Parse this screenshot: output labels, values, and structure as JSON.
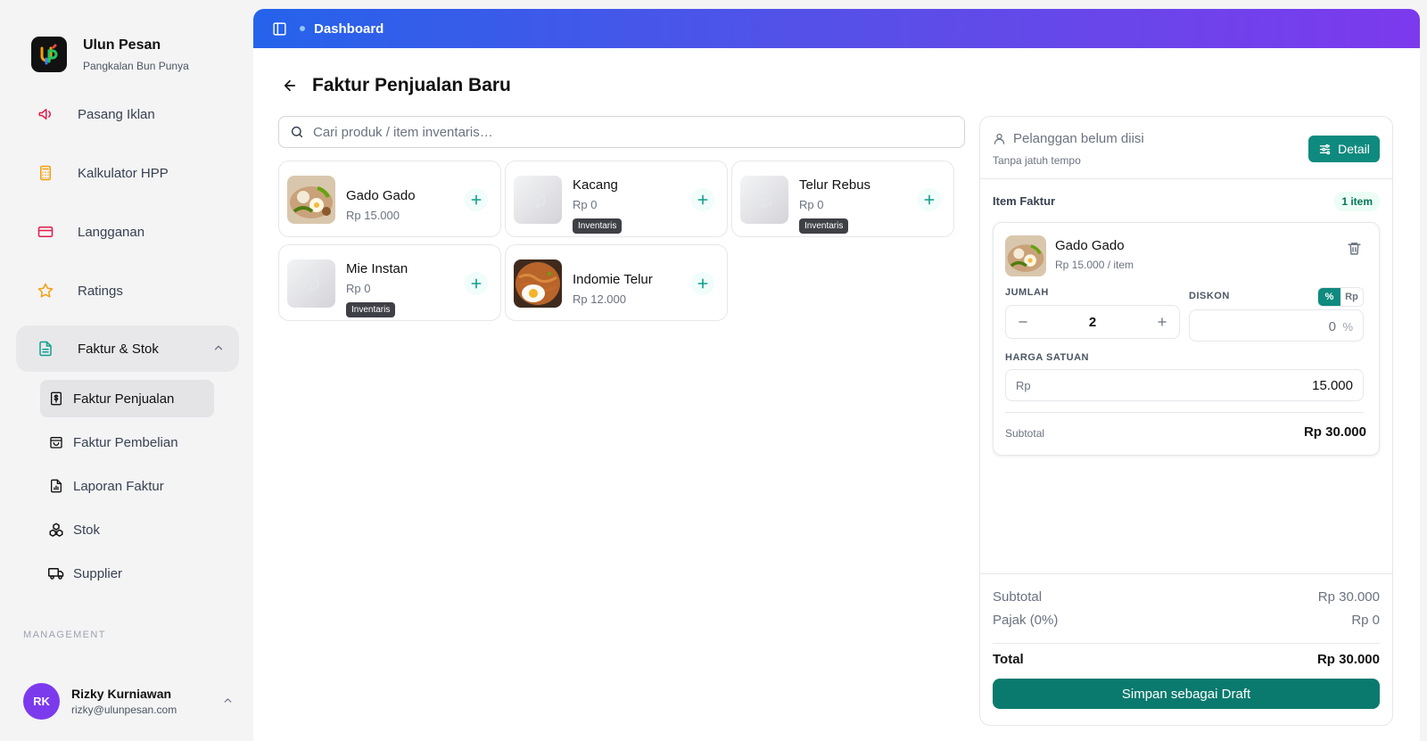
{
  "brand": {
    "name": "Ulun Pesan",
    "subtitle": "Pangkalan Bun Punya"
  },
  "sidebar": {
    "items": [
      {
        "label": "Pasang Iklan",
        "icon": "megaphone-icon"
      },
      {
        "label": "Kalkulator HPP",
        "icon": "calculator-icon"
      },
      {
        "label": "Langganan",
        "icon": "credit-card-icon"
      },
      {
        "label": "Ratings",
        "icon": "star-icon"
      },
      {
        "label": "Faktur & Stok",
        "icon": "document-icon",
        "expanded": true
      }
    ],
    "subitems": [
      {
        "label": "Faktur Penjualan",
        "icon": "receipt-icon",
        "active": true
      },
      {
        "label": "Faktur Pembelian",
        "icon": "shopping-bag-icon"
      },
      {
        "label": "Laporan Faktur",
        "icon": "report-icon"
      },
      {
        "label": "Stok",
        "icon": "boxes-icon"
      },
      {
        "label": "Supplier",
        "icon": "truck-icon"
      }
    ],
    "section_label": "MANAGEMENT"
  },
  "user": {
    "initials": "RK",
    "name": "Rizky Kurniawan",
    "email": "rizky@ulunpesan.com"
  },
  "topbar": {
    "breadcrumb": "Dashboard"
  },
  "page": {
    "title": "Faktur Penjualan Baru"
  },
  "search": {
    "placeholder": "Cari produk / item inventaris…"
  },
  "products": [
    {
      "name": "Gado Gado",
      "price": "Rp 15.000",
      "badge": "",
      "image": "gado-gado"
    },
    {
      "name": "Kacang",
      "price": "Rp 0",
      "badge": "Inventaris",
      "image": "placeholder"
    },
    {
      "name": "Telur Rebus",
      "price": "Rp 0",
      "badge": "Inventaris",
      "image": "placeholder"
    },
    {
      "name": "Mie Instan",
      "price": "Rp 0",
      "badge": "Inventaris",
      "image": "placeholder"
    },
    {
      "name": "Indomie Telur",
      "price": "Rp 12.000",
      "badge": "",
      "image": "indomie-telur"
    }
  ],
  "panel": {
    "customer": "Pelanggan belum diisi",
    "due": "Tanpa jatuh tempo",
    "detail_label": "Detail",
    "items_heading": "Item Faktur",
    "items_count": "1 item",
    "item": {
      "name": "Gado Gado",
      "unit_price": "Rp 15.000 / item",
      "qty_label": "JUMLAH",
      "qty": "2",
      "discount_label": "DISKON",
      "discount_modes": [
        "%",
        "Rp"
      ],
      "discount_value": "0",
      "discount_unit": "%",
      "price_label": "HARGA SATUAN",
      "currency": "Rp",
      "price_value": "15.000",
      "subtotal_label": "Subtotal",
      "subtotal_value": "Rp 30.000"
    },
    "totals": {
      "subtotal_label": "Subtotal",
      "subtotal_value": "Rp 30.000",
      "tax_label": "Pajak (0%)",
      "tax_value": "Rp 0",
      "total_label": "Total",
      "total_value": "Rp 30.000"
    },
    "save_label": "Simpan sebagai Draft"
  },
  "colors": {
    "accent": "#0f8a7e",
    "topbar_start": "#2563eb",
    "topbar_end": "#7c3aed",
    "avatar": "#7c3aed"
  }
}
